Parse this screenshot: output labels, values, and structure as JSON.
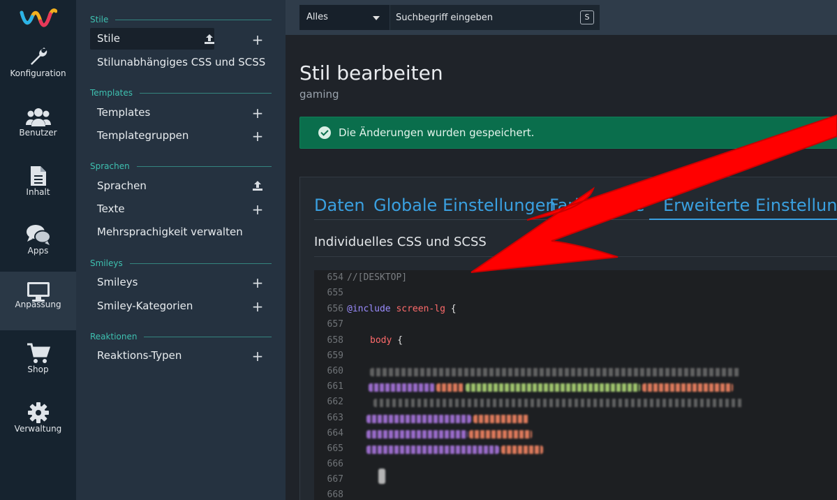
{
  "rail": {
    "items": [
      {
        "label": "Konfiguration",
        "icon": "wrench-icon"
      },
      {
        "label": "Benutzer",
        "icon": "users-icon"
      },
      {
        "label": "Inhalt",
        "icon": "document-icon"
      },
      {
        "label": "Apps",
        "icon": "chat-icon"
      },
      {
        "label": "Anpassung",
        "icon": "monitor-icon"
      },
      {
        "label": "Shop",
        "icon": "cart-icon"
      },
      {
        "label": "Verwaltung",
        "icon": "gear-icon"
      }
    ]
  },
  "submenu": {
    "sections": [
      {
        "title": "Stile",
        "items": [
          {
            "label": "Stile"
          },
          {
            "label": "Stilunabhängiges CSS und SCSS"
          }
        ]
      },
      {
        "title": "Templates",
        "items": [
          {
            "label": "Templates"
          },
          {
            "label": "Templategruppen"
          }
        ]
      },
      {
        "title": "Sprachen",
        "items": [
          {
            "label": "Sprachen"
          },
          {
            "label": "Texte"
          },
          {
            "label": "Mehrsprachigkeit verwalten"
          }
        ]
      },
      {
        "title": "Smileys",
        "items": [
          {
            "label": "Smileys"
          },
          {
            "label": "Smiley-Kategorien"
          }
        ]
      },
      {
        "title": "Reaktionen",
        "items": [
          {
            "label": "Reaktions-Typen"
          }
        ]
      }
    ]
  },
  "search": {
    "scope": "Alles",
    "placeholder": "Suchbegriff eingeben",
    "shortcut": "S"
  },
  "main": {
    "title": "Stil bearbeiten",
    "subtitle": "gaming",
    "alert": "Die Änderungen wurden gespeichert.",
    "tabs": [
      {
        "label": "Daten"
      },
      {
        "label": "Globale Einstellungen"
      },
      {
        "label": "Farbpalette"
      },
      {
        "label": "Erweiterte Einstellungen"
      }
    ],
    "section_title": "Individuelles CSS und SCSS"
  },
  "code": {
    "line_numbers": [
      "654",
      "655",
      "656",
      "657",
      "658",
      "659",
      "660",
      "661",
      "662",
      "663",
      "664",
      "665",
      "666",
      "667",
      "668"
    ],
    "line654": "//[DESKTOP]",
    "line656_kw": "@include",
    "line656_name": "screen-lg",
    "line656_brace": "{",
    "line658_sel": "body",
    "line658_brace": "{"
  },
  "colors": {
    "accent": "#3aa0e0",
    "success": "#0a6e4c",
    "section": "#3ec0b0",
    "arrow": "#ff0000"
  }
}
